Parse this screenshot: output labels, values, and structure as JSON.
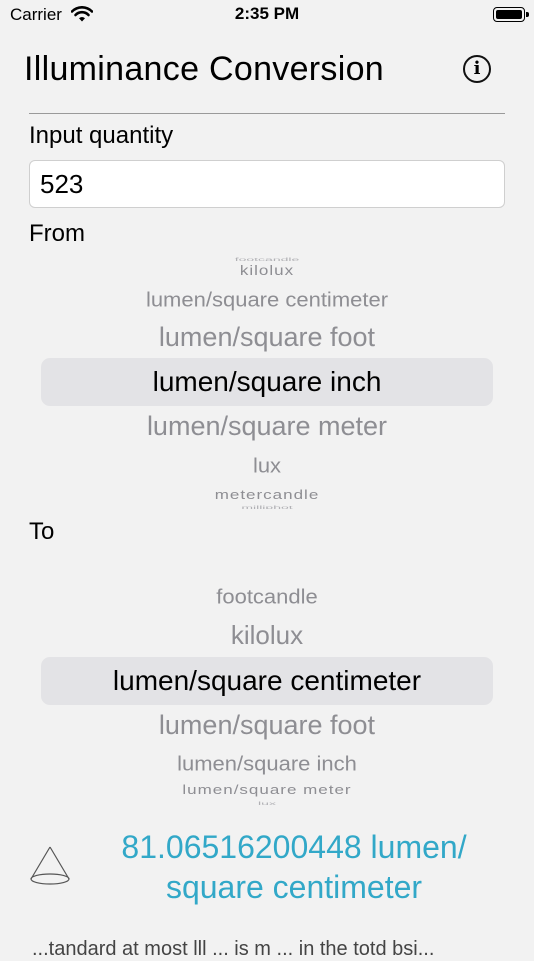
{
  "status_bar": {
    "carrier": "Carrier",
    "time": "2:35 PM"
  },
  "header": {
    "title": "Illuminance Conversion",
    "info_icon": "info-circle-icon"
  },
  "input": {
    "label": "Input quantity",
    "value": "523"
  },
  "from": {
    "label": "From",
    "items": [
      "footcandle",
      "kilolux",
      "lumen/square centimeter",
      "lumen/square foot",
      "lumen/square inch",
      "lumen/square meter",
      "lux",
      "metercandle",
      "milliphot"
    ],
    "selected": "lumen/square inch"
  },
  "to": {
    "label": "To",
    "items": [
      "footcandle",
      "kilolux",
      "lumen/square centimeter",
      "lumen/square foot",
      "lumen/square inch",
      "lumen/square meter",
      "lux"
    ],
    "selected": "lumen/square centimeter"
  },
  "result": {
    "line1": "81.06516200448 lumen/",
    "line2": "square centimeter",
    "icon": "cone-icon",
    "color": "#32a8c8"
  },
  "footer": {
    "text": "...tandard at most lll ... is m ... in the totd bsi..."
  }
}
